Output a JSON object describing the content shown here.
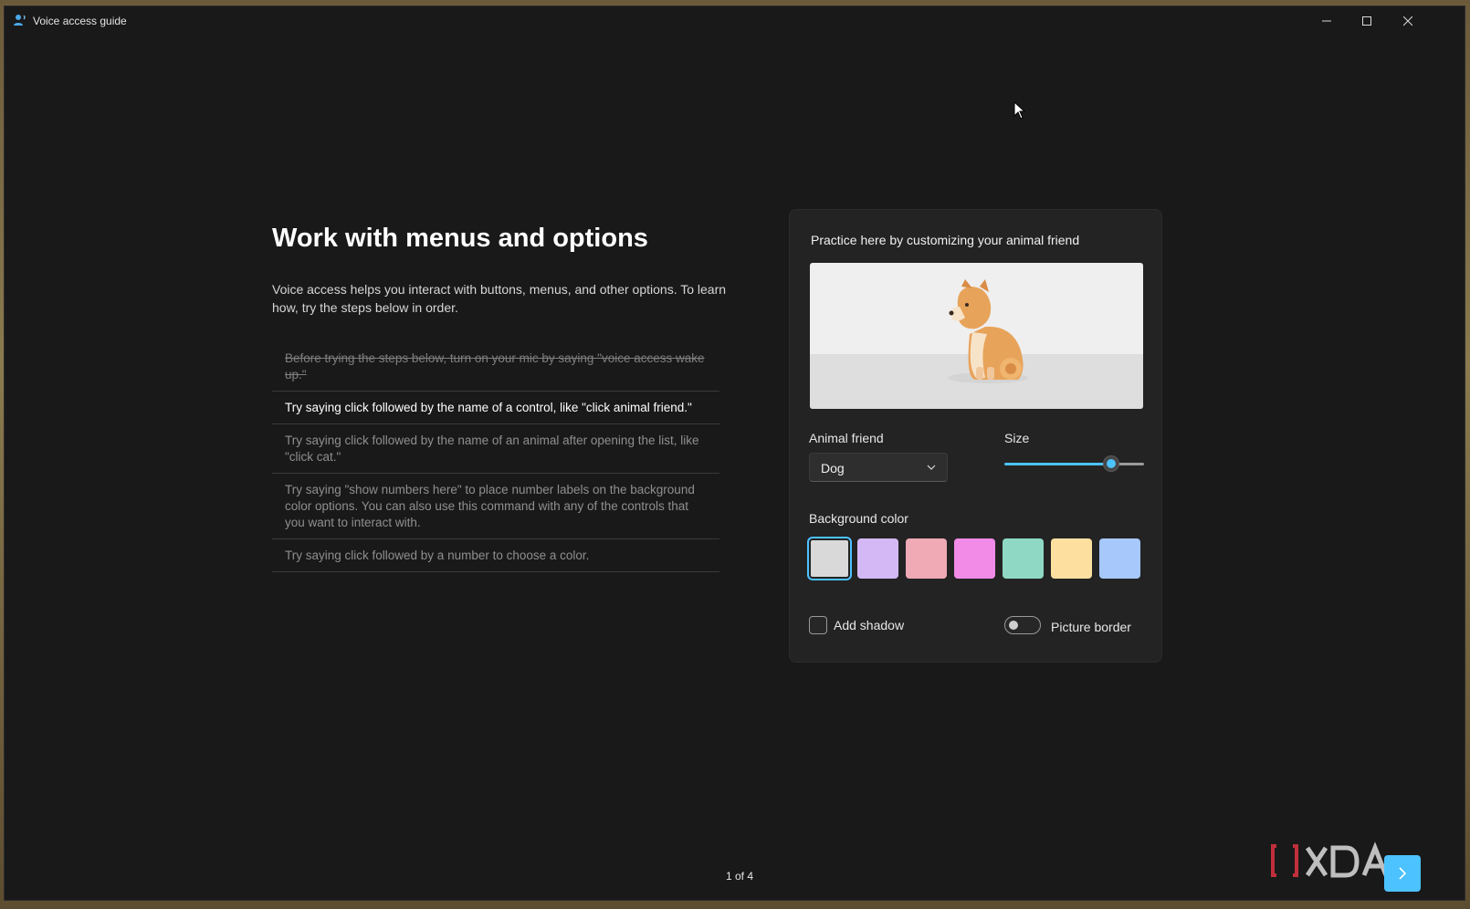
{
  "window": {
    "title": "Voice access guide"
  },
  "main": {
    "heading": "Work with menus and options",
    "intro": "Voice access helps you interact with buttons, menus, and other options. To learn how, try the steps below in order.",
    "steps": [
      {
        "text": "Before trying the steps below, turn on your mic by saying \"voice access wake up.\"",
        "state": "done"
      },
      {
        "text": "Try saying click followed by the name of a control, like \"click animal friend.\"",
        "state": "active"
      },
      {
        "text": "Try saying click followed by the name of an animal after opening the list, like \"click cat.\"",
        "state": "pending"
      },
      {
        "text": "Try saying \"show numbers here\" to place number labels on the background color options. You can also use this command with any of the controls that you want to interact with.",
        "state": "pending"
      },
      {
        "text": "Try saying click followed by a number to choose a color.",
        "state": "pending"
      }
    ]
  },
  "practice": {
    "title": "Practice here by customizing your animal friend",
    "animal_label": "Animal friend",
    "animal_value": "Dog",
    "size_label": "Size",
    "size_value": 0.8,
    "background_label": "Background color",
    "colors": [
      "#d9d9d9",
      "#d3b8f5",
      "#f0aab5",
      "#f28be8",
      "#8fd9c4",
      "#fde0a0",
      "#a7c8fb"
    ],
    "selected_color_index": 0,
    "shadow_label": "Add shadow",
    "shadow_checked": false,
    "border_label": "Picture border",
    "border_on": false
  },
  "footer": {
    "page_indicator": "1 of 4"
  },
  "accent": "#4cc2ff"
}
